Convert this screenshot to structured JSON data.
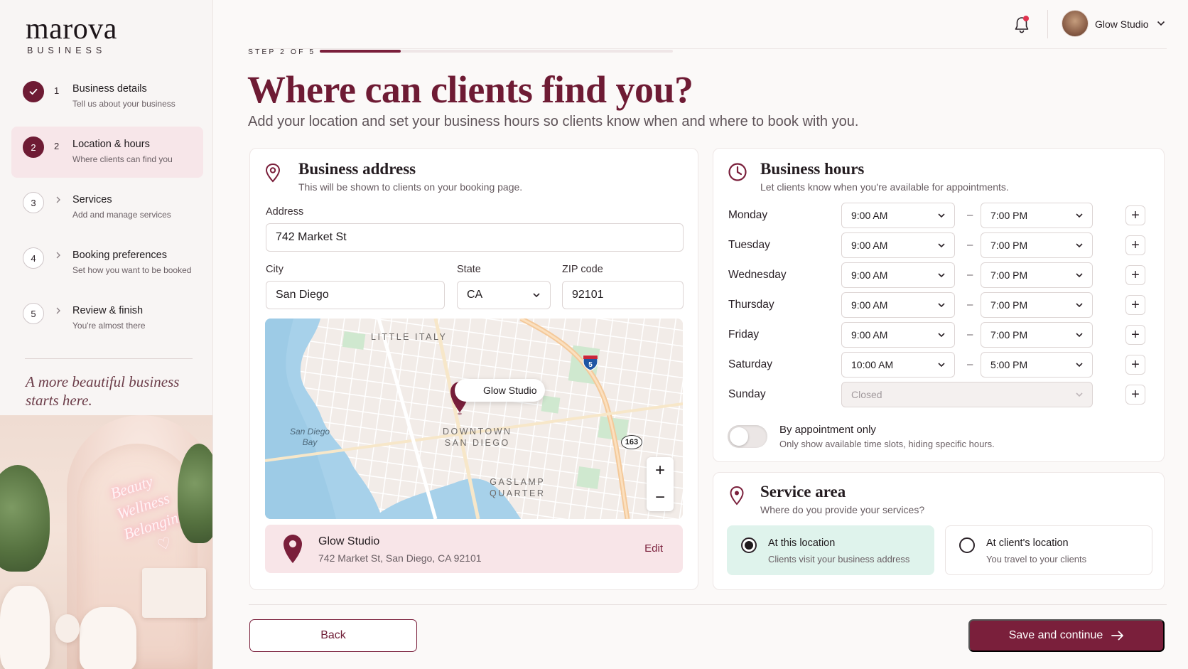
{
  "brand": {
    "name": "marova",
    "sub": "BUSINESS"
  },
  "steps": [
    {
      "num": "1",
      "title": "Business details",
      "desc": "Tell us about your business",
      "state": "done"
    },
    {
      "num": "2",
      "title": "Location & hours",
      "desc": "Where clients can find you",
      "state": "current"
    },
    {
      "num": "3",
      "title": "Services",
      "desc": "Add and manage services",
      "state": "upcoming"
    },
    {
      "num": "4",
      "title": "Booking preferences",
      "desc": "Set how you want to be booked",
      "state": "upcoming"
    },
    {
      "num": "5",
      "title": "Review & finish",
      "desc": "You're almost there",
      "state": "upcoming"
    }
  ],
  "tagline": "A more beautiful business starts here.",
  "salon_sign": [
    "Beauty",
    "Wellness",
    "Belonging"
  ],
  "topbar": {
    "user_name": "Glow Studio",
    "has_notification": true
  },
  "progress": {
    "label": "STEP 2 OF 5",
    "fraction": 0.23
  },
  "page": {
    "title": "Where can clients find you?",
    "subtitle": "Add your location and set your business hours so clients know when and where to book with you."
  },
  "address_card": {
    "title": "Business address",
    "subtitle": "This will be shown to clients on your booking page.",
    "address_label": "Address",
    "address_value": "742 Market St",
    "city_label": "City",
    "city_value": "San Diego",
    "state_label": "State",
    "state_value": "CA",
    "zip_label": "ZIP code",
    "zip_value": "92101"
  },
  "map": {
    "labels": {
      "little_italy": "LITTLE ITALY",
      "downtown": "DOWNTOWN\nSAN DIEGO",
      "gaslamp": "GASLAMP\nQUARTER",
      "bay": "San Diego\nBay"
    },
    "pin_label": "Glow Studio",
    "interstate": "5",
    "route": "163",
    "zoom_in": "+",
    "zoom_out": "−"
  },
  "location_summary": {
    "name": "Glow Studio",
    "address": "742 Market St, San Diego, CA 92101",
    "edit_label": "Edit"
  },
  "hours_card": {
    "title": "Business hours",
    "subtitle": "Let clients know when you're available for appointments.",
    "days": [
      {
        "day": "Monday",
        "open": "9:00 AM",
        "close": "7:00 PM"
      },
      {
        "day": "Tuesday",
        "open": "9:00 AM",
        "close": "7:00 PM"
      },
      {
        "day": "Wednesday",
        "open": "9:00 AM",
        "close": "7:00 PM"
      },
      {
        "day": "Thursday",
        "open": "9:00 AM",
        "close": "7:00 PM"
      },
      {
        "day": "Friday",
        "open": "9:00 AM",
        "close": "7:00 PM"
      },
      {
        "day": "Saturday",
        "open": "10:00 AM",
        "close": "5:00 PM"
      },
      {
        "day": "Sunday",
        "closed_label": "Closed"
      }
    ],
    "separator": "–",
    "appointment_only": {
      "title": "By appointment only",
      "subtitle": "Only show available time slots, hiding specific hours.",
      "enabled": false
    }
  },
  "service_area": {
    "title": "Service area",
    "subtitle": "Where do you provide your services?",
    "options": [
      {
        "title": "At this location",
        "subtitle": "Clients visit your business address",
        "selected": true
      },
      {
        "title": "At client's location",
        "subtitle": "You travel to your clients",
        "selected": false
      }
    ]
  },
  "footer": {
    "back_label": "Back",
    "save_label": "Save and continue"
  },
  "colors": {
    "accent": "#7a1f3b",
    "accent_light": "#f8e5e8",
    "selected_option": "#dff3ec",
    "notification": "#e0334f"
  }
}
